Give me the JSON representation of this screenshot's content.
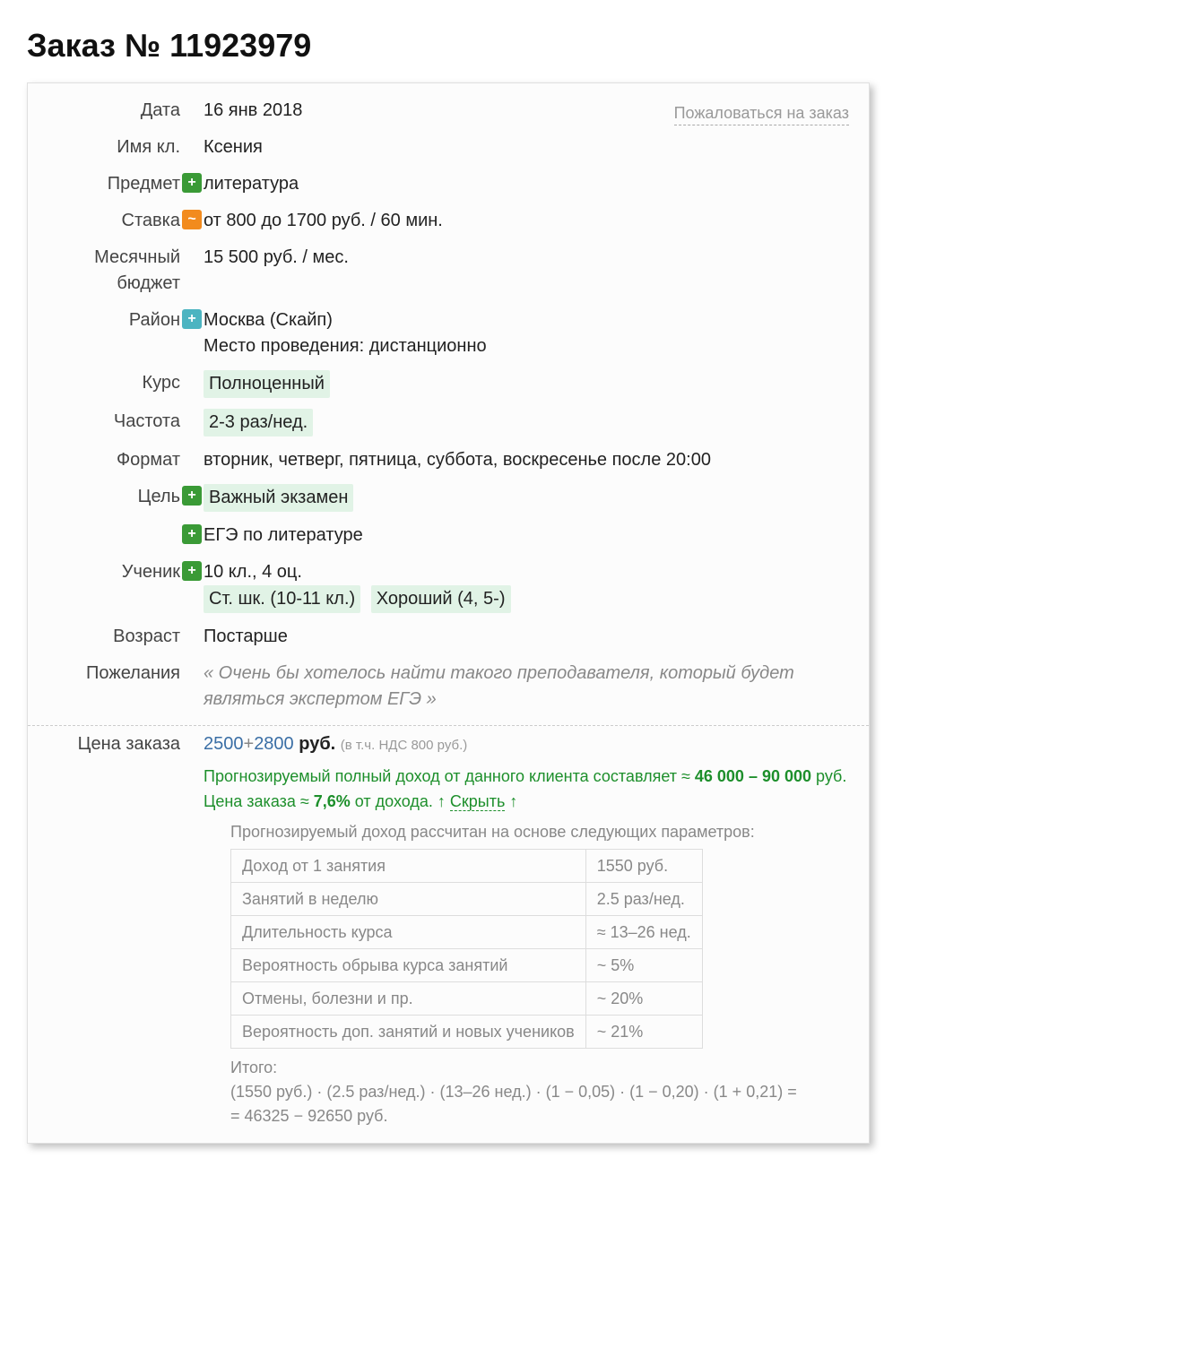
{
  "title": "Заказ № 11923979",
  "complain_label": "Пожаловаться на заказ",
  "labels": {
    "date": "Дата",
    "name": "Имя кл.",
    "subject": "Предмет",
    "rate": "Ставка",
    "budget_l1": "Месячный",
    "budget_l2": "бюджет",
    "district": "Район",
    "course": "Курс",
    "frequency": "Частота",
    "format": "Формат",
    "goal": "Цель",
    "student": "Ученик",
    "age": "Возраст",
    "wishes": "Пожелания",
    "price": "Цена заказа"
  },
  "values": {
    "date": "16 янв 2018",
    "name": "Ксения",
    "subject": "литература",
    "rate": "от 800 до 1700 руб. / 60 мин.",
    "budget": "15 500 руб. / мес.",
    "district_l1": "Москва (Скайп)",
    "district_l2": "Место проведения: дистанционно",
    "course": "Полноценный",
    "frequency": "2-3 раз/нед.",
    "format": "вторник, четверг, пятница, суббота, воскресенье после 20:00",
    "goal": "Важный экзамен",
    "goal2": "ЕГЭ по литературе",
    "student_l1": "10 кл., 4 оц.",
    "student_pill1": "Ст. шк. (10-11 кл.)",
    "student_pill2": "Хороший (4, 5-)",
    "age": "Постарше",
    "wishes": "« Очень бы хотелось найти такого преподавателя, который будет являться экспертом ЕГЭ »"
  },
  "price": {
    "p1": "2500",
    "plus": "+",
    "p2": "2800",
    "rub": " руб. ",
    "vat": "(в т.ч. НДС 800 руб.)",
    "forecast_part1": "Прогнозируемый полный доход от данного клиента составляет ≈ ",
    "forecast_bold1": "46 000 – 90 000",
    "forecast_part1b": " руб.",
    "forecast_part2a": "Цена заказа ≈ ",
    "forecast_bold2": "7,6%",
    "forecast_part2b": " от дохода. ",
    "hide_prefix": "↑ ",
    "hide": "Скрыть",
    "hide_suffix": " ↑",
    "fc_title": "Прогнозируемый доход рассчитан на основе следующих параметров:",
    "table": [
      [
        "Доход от 1 занятия",
        "1550 руб."
      ],
      [
        "Занятий в неделю",
        "2.5 раз/нед."
      ],
      [
        "Длительность курса",
        "≈ 13–26 нед."
      ],
      [
        "Вероятность обрыва курса занятий",
        "~ 5%"
      ],
      [
        "Отмены, болезни и пр.",
        "~ 20%"
      ],
      [
        "Вероятность доп. занятий и новых учеников",
        "~ 21%"
      ]
    ],
    "totals_l1": "Итого:",
    "totals_l2": "(1550 руб.) · (2.5 раз/нед.) · (13–26 нед.) · (1 − 0,05) · (1 − 0,20) · (1 + 0,21) =",
    "totals_l3": "= 46325 − 92650 руб."
  }
}
